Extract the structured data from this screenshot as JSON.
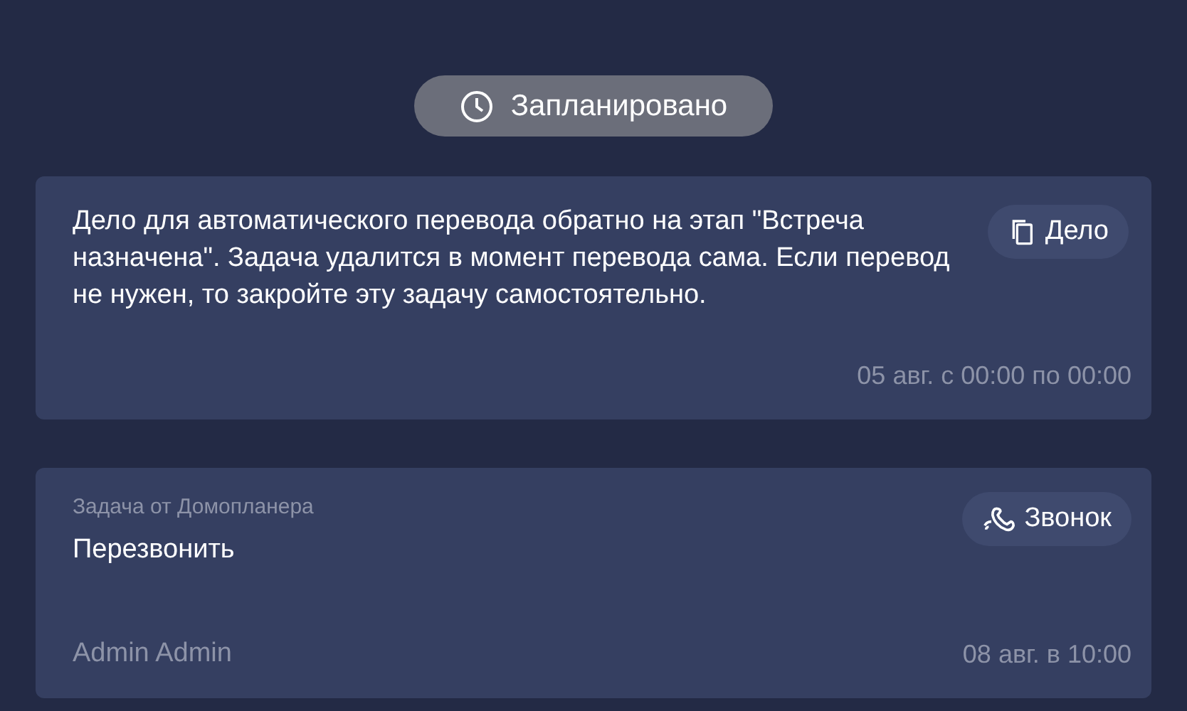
{
  "status": {
    "label": "Запланировано"
  },
  "tasks": [
    {
      "kind": "note",
      "text": "Дело для автоматического перевода обратно на этап \"Встреча назначена\". Задача удалится в момент перевода сама. Если перевод не нужен, то закройте эту задачу самостоятельно.",
      "badge": {
        "kind": "doc",
        "label": "Дело"
      },
      "time": "05 авг. с 00:00 по 00:00"
    },
    {
      "kind": "task",
      "source": "Задача от Домопланера",
      "text": "Перезвонить",
      "badge": {
        "kind": "call",
        "label": "Звонок"
      },
      "author": "Admin Admin",
      "time": "08 авг. в 10:00"
    }
  ]
}
